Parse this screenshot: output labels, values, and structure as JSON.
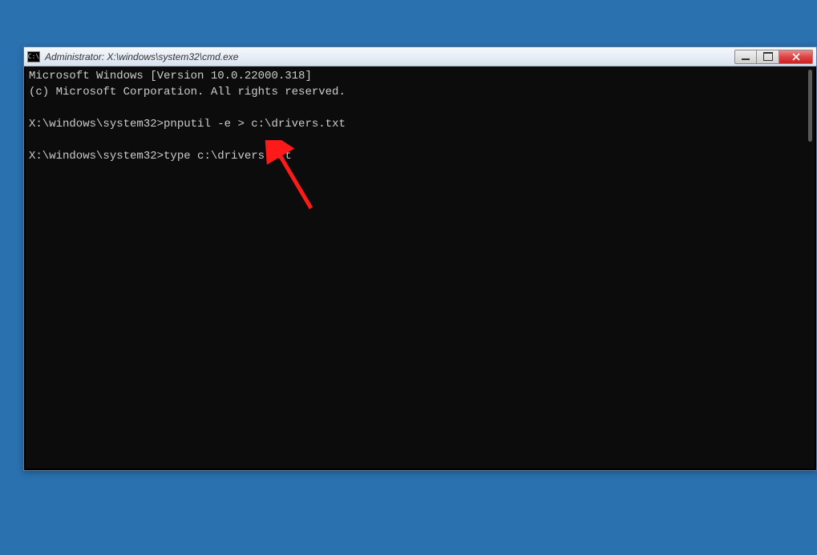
{
  "window": {
    "title": "Administrator: X:\\windows\\system32\\cmd.exe",
    "icon_text": "C:\\"
  },
  "terminal": {
    "line1": "Microsoft Windows [Version 10.0.22000.318]",
    "line2": "(c) Microsoft Corporation. All rights reserved.",
    "blank1": "",
    "prompt1_path": "X:\\windows\\system32>",
    "command1": "pnputil -e > c:\\drivers.txt",
    "blank2": "",
    "prompt2_path": "X:\\windows\\system32>",
    "command2": "type c:\\drivers.txt"
  }
}
